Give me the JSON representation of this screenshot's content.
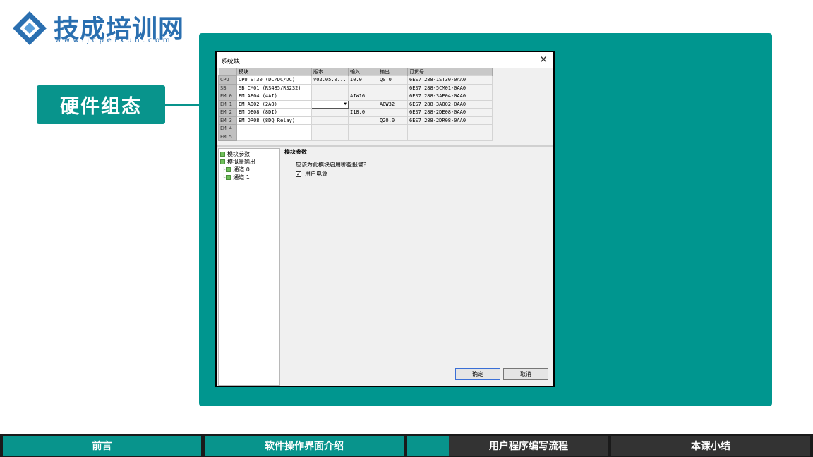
{
  "logo": {
    "name": "技成培训网",
    "url": "www.jcpeixun.com",
    "colors": {
      "blue": "#2a6fb0"
    }
  },
  "section_label": "硬件组态",
  "dialog": {
    "title": "系统块",
    "close_glyph": "✕",
    "columns": [
      "",
      "模块",
      "版本",
      "输入",
      "输出",
      "订货号"
    ],
    "rows": [
      {
        "slot": "CPU",
        "module": "CPU ST30 (DC/DC/DC)",
        "version": "V02.05.0...",
        "input": "I0.0",
        "output": "Q0.0",
        "order": "6ES7 288-1ST30-0AA0"
      },
      {
        "slot": "SB",
        "module": "SB CM01 (RS485/RS232)",
        "version": "",
        "input": "",
        "output": "",
        "order": "6ES7 288-5CM01-0AA0"
      },
      {
        "slot": "EM 0",
        "module": "EM AE04 (4AI)",
        "version": "",
        "input": "AIW16",
        "output": "",
        "order": "6ES7 288-3AE04-0AA0"
      },
      {
        "slot": "EM 1",
        "module": "EM AQ02 (2AQ)",
        "version": "",
        "input": "",
        "output": "AQW32",
        "order": "6ES7 288-3AQ02-0AA0"
      },
      {
        "slot": "EM 2",
        "module": "EM DE08 (8DI)",
        "version": "",
        "input": "I18.0",
        "output": "",
        "order": "6ES7 288-2DE08-0AA0"
      },
      {
        "slot": "EM 3",
        "module": "EM DR08 (8DQ Relay)",
        "version": "",
        "input": "",
        "output": "Q20.0",
        "order": "6ES7 288-2DR08-0AA0"
      },
      {
        "slot": "EM 4",
        "module": "",
        "version": "",
        "input": "",
        "output": "",
        "order": ""
      },
      {
        "slot": "EM 5",
        "module": "",
        "version": "",
        "input": "",
        "output": "",
        "order": ""
      }
    ],
    "tree": [
      {
        "label": "模块参数",
        "level": 0
      },
      {
        "label": "模拟量输出",
        "level": 0
      },
      {
        "label": "通道 0",
        "level": 1
      },
      {
        "label": "通道 1",
        "level": 1
      }
    ],
    "param_title": "模块参数",
    "param_question": "应该为此模块启用哪些报警？",
    "checkbox_label": "用户电源",
    "checkbox_checked": true,
    "ok_label": "确定",
    "cancel_label": "取消"
  },
  "bottom_nav": [
    "前言",
    "软件操作界面介绍",
    "用户程序编写流程",
    "本课小结"
  ],
  "colors": {
    "teal": "#00968f",
    "dark_tab": "#333333"
  }
}
